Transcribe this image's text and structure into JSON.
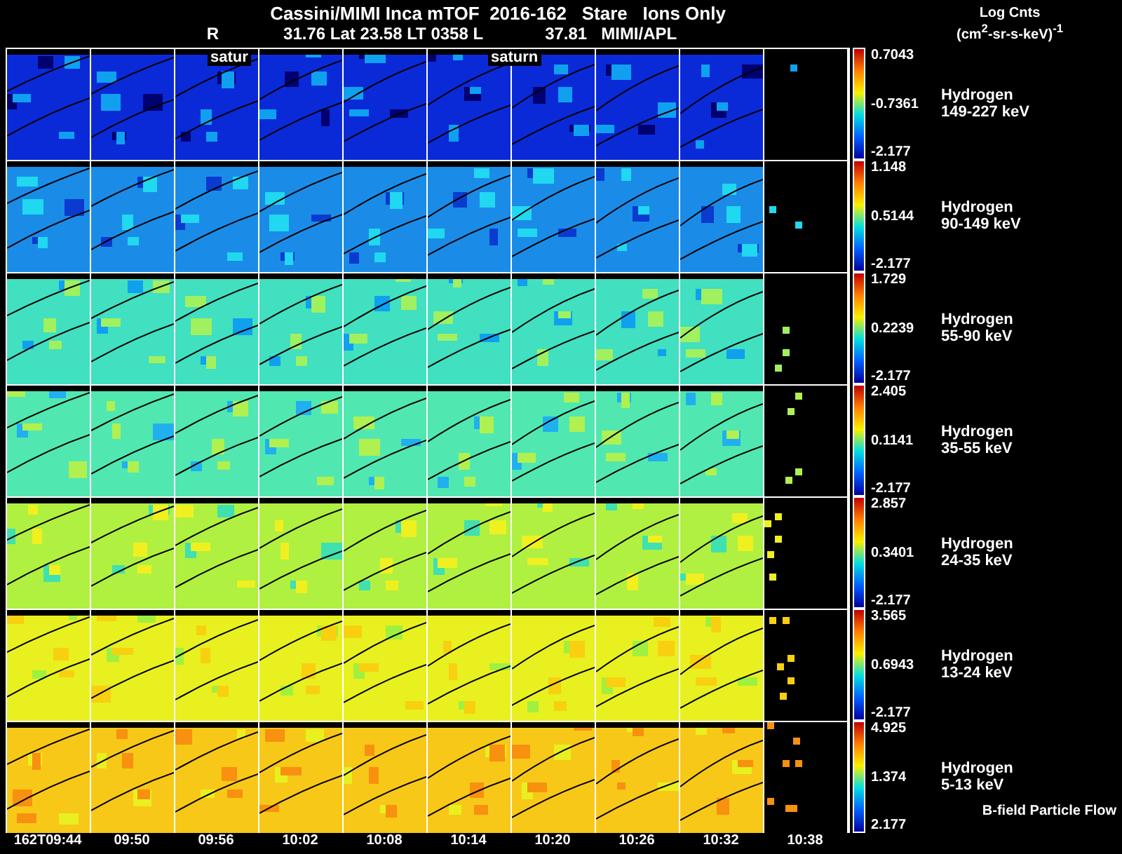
{
  "title": "Cassini/MIMI Inca mTOF  2016-162   Stare   Ions Only",
  "subtitle": [
    "R",
    "31.76 Lat 23.58 LT 0358 L",
    "37.81",
    "MIMI/APL"
  ],
  "units": {
    "label": "Log Cnts",
    "unit": "(cm$^{2}$-sr-s-keV)$^{-1}$"
  },
  "overlay_labels": [
    "satur",
    "saturn"
  ],
  "rows": [
    {
      "species": "Hydrogen",
      "energy": "149-227 keV",
      "max": "0.7043",
      "mid": "-0.7361",
      "min": "-2.177"
    },
    {
      "species": "Hydrogen",
      "energy": "90-149 keV",
      "max": "1.148",
      "mid": "0.5144",
      "min": "-2.177"
    },
    {
      "species": "Hydrogen",
      "energy": "55-90 keV",
      "max": "1.729",
      "mid": "0.2239",
      "min": "-2.177"
    },
    {
      "species": "Hydrogen",
      "energy": "35-55 keV",
      "max": "2.405",
      "mid": "0.1141",
      "min": "-2.177"
    },
    {
      "species": "Hydrogen",
      "energy": "24-35 keV",
      "max": "2.857",
      "mid": "0.3401",
      "min": "-2.177"
    },
    {
      "species": "Hydrogen",
      "energy": "13-24 keV",
      "max": "3.565",
      "mid": "0.6943",
      "min": "-2.177"
    },
    {
      "species": "Hydrogen",
      "energy": "5-13 keV",
      "max": "4.925",
      "mid": "1.374",
      "min": "2.177"
    }
  ],
  "footnote": "B-field Particle Flow",
  "times": [
    "162T09:44",
    "09:50",
    "09:56",
    "10:02",
    "10:08",
    "10:14",
    "10:20",
    "10:26",
    "10:32",
    "10:38"
  ]
}
